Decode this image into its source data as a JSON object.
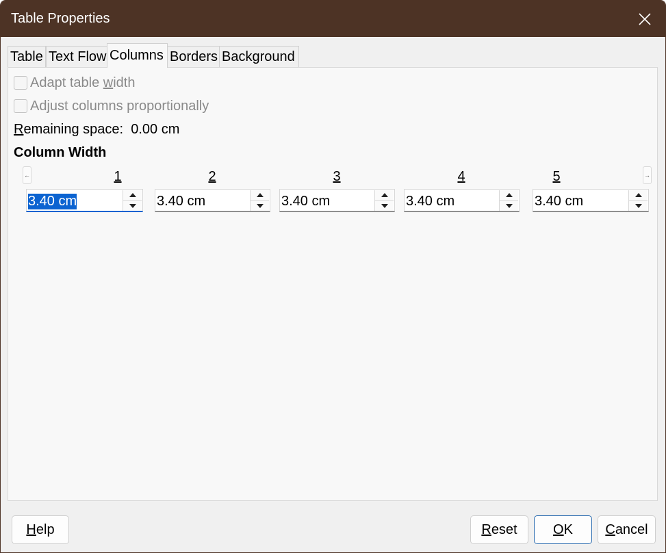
{
  "window": {
    "title": "Table Properties"
  },
  "tabs": [
    {
      "label": "Table"
    },
    {
      "label": "Text Flow"
    },
    {
      "label": "Columns"
    },
    {
      "label": "Borders"
    },
    {
      "label": "Background"
    }
  ],
  "options": {
    "adapt_before": "Adapt table ",
    "adapt_mnemonic": "w",
    "adapt_after": "idth",
    "adjust_before": "Adjust columns ",
    "adjust_mnemonic": "p",
    "adjust_after": "roportionally",
    "adapt_checked": false,
    "adjust_checked": false
  },
  "remaining": {
    "mnemonic": "R",
    "label_rest": "emaining space:",
    "value": "0.00 cm"
  },
  "column_width": {
    "title": "Column Width",
    "columns": [
      {
        "label": "1",
        "value": "3.40 cm"
      },
      {
        "label": "2",
        "value": "3.40 cm"
      },
      {
        "label": "3",
        "value": "3.40 cm"
      },
      {
        "label": "4",
        "value": "3.40 cm"
      },
      {
        "label": "5",
        "value": "3.40 cm"
      }
    ]
  },
  "buttons": {
    "help_mnemonic": "H",
    "help_rest": "elp",
    "reset_mnemonic": "R",
    "reset_rest": "eset",
    "ok_mnemonic": "O",
    "ok_rest": "K",
    "cancel_mnemonic": "C",
    "cancel_rest": "ancel"
  },
  "colors": {
    "titlebar": "#4d3325",
    "selection": "#0b63d1"
  },
  "icons": {
    "close": "close-icon",
    "scroll_left": "arrow-left-icon",
    "scroll_right": "arrow-right-icon",
    "spin_up": "triangle-up-icon",
    "spin_down": "triangle-down-icon"
  }
}
